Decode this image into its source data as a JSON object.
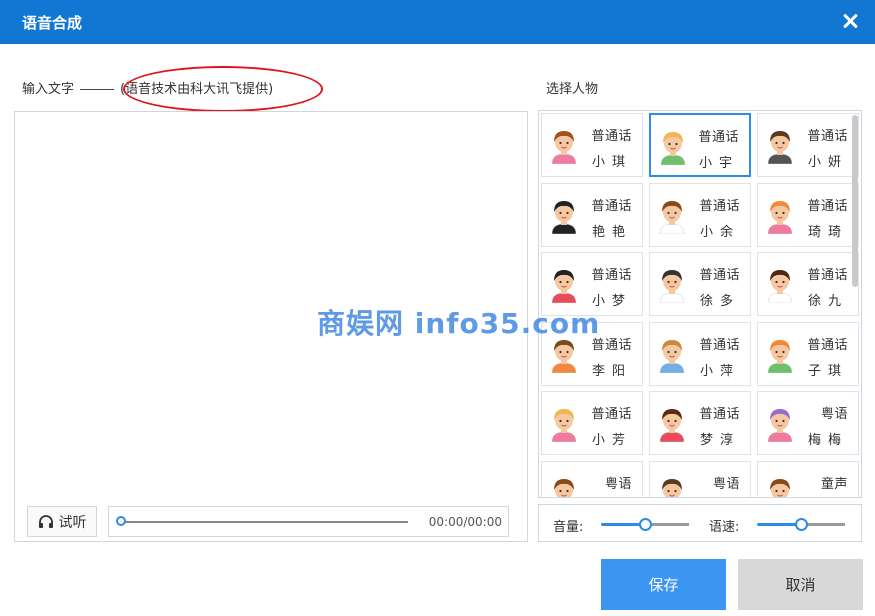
{
  "dialog": {
    "title": "语音合成"
  },
  "input": {
    "label": "输入文字",
    "provider_note": "(语音技术由科大讯飞提供)",
    "value": ""
  },
  "player": {
    "listen_label": "试听",
    "time": "00:00/00:00",
    "progress": 0
  },
  "voices": {
    "label": "选择人物",
    "selected_index": 1,
    "items": [
      {
        "lang": "普通话",
        "name": "小琪",
        "hair": "#a0521a",
        "shirt": "#f07aa0",
        "skin": "#f6c8a2"
      },
      {
        "lang": "普通话",
        "name": "小宇",
        "hair": "#f2b552",
        "shirt": "#6fc06a",
        "skin": "#f6c8a2"
      },
      {
        "lang": "普通话",
        "name": "小妍",
        "hair": "#5b3a1e",
        "shirt": "#555555",
        "skin": "#f6c8a2"
      },
      {
        "lang": "普通话",
        "name": "艳艳",
        "hair": "#222222",
        "shirt": "#222222",
        "skin": "#f6c8a2"
      },
      {
        "lang": "普通话",
        "name": "小余",
        "hair": "#8a4a1c",
        "shirt": "#ffffff",
        "skin": "#f6c8a2"
      },
      {
        "lang": "普通话",
        "name": "琦琦",
        "hair": "#f08a3a",
        "shirt": "#f07aa0",
        "skin": "#f6c8a2"
      },
      {
        "lang": "普通话",
        "name": "小梦",
        "hair": "#222222",
        "shirt": "#e94b5a",
        "skin": "#f6c8a2"
      },
      {
        "lang": "普通话",
        "name": "徐多",
        "hair": "#333333",
        "shirt": "#ffffff",
        "skin": "#f6c8a2"
      },
      {
        "lang": "普通话",
        "name": "徐九",
        "hair": "#4a2a14",
        "shirt": "#ffffff",
        "skin": "#f6c8a2"
      },
      {
        "lang": "普通话",
        "name": "李阳",
        "hair": "#7a4a20",
        "shirt": "#f08a3a",
        "skin": "#f6c8a2"
      },
      {
        "lang": "普通话",
        "name": "小萍",
        "hair": "#c78a3a",
        "shirt": "#6fb0e8",
        "skin": "#f6c8a2"
      },
      {
        "lang": "普通话",
        "name": "子琪",
        "hair": "#f08a3a",
        "shirt": "#6fc06a",
        "skin": "#f6c8a2"
      },
      {
        "lang": "普通话",
        "name": "小芳",
        "hair": "#f2b552",
        "shirt": "#f07aa0",
        "skin": "#f6c8a2"
      },
      {
        "lang": "普通话",
        "name": "梦淳",
        "hair": "#5b2a14",
        "shirt": "#e94b5a",
        "skin": "#f6c8a2"
      },
      {
        "lang": "粤语",
        "name": "梅梅",
        "hair": "#9b6bc8",
        "shirt": "#f07aa0",
        "skin": "#f6c8a2"
      },
      {
        "lang": "粤语",
        "name": "",
        "hair": "#8a4a1c",
        "shirt": "#6fc06a",
        "skin": "#f6c8a2"
      },
      {
        "lang": "粤语",
        "name": "",
        "hair": "#5b3a1e",
        "shirt": "#f07aa0",
        "skin": "#f6c8a2"
      },
      {
        "lang": "童声",
        "name": "",
        "hair": "#8a4a1c",
        "shirt": "#e94b5a",
        "skin": "#f6c8a2"
      }
    ]
  },
  "settings": {
    "volume_label": "音量:",
    "speed_label": "语速:",
    "volume": 0.5,
    "speed": 0.5
  },
  "buttons": {
    "save": "保存",
    "cancel": "取消"
  },
  "watermark": "商娱网 info35.com",
  "colors": {
    "titlebar": "#1277d3",
    "accent": "#2e8be6",
    "save": "#3a96f0",
    "cancel": "#d8d8d8",
    "annotation": "#e0141e"
  }
}
